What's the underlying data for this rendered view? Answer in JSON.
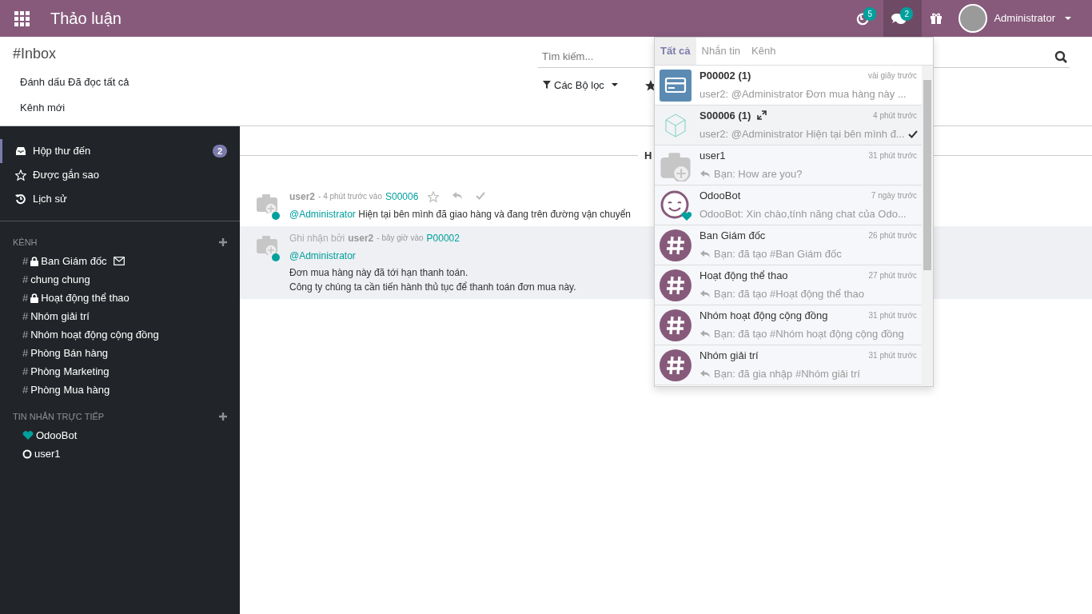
{
  "topbar": {
    "title": "Thảo luận",
    "activity_count": "5",
    "chat_count": "2",
    "chat_open": true,
    "user_name": "Administrator"
  },
  "control_panel": {
    "breadcrumb": "#Inbox",
    "buttons": [
      "Đánh dấu Đã đọc tất cả",
      "Kênh mới"
    ],
    "search": {
      "placeholder": "Tìm kiếm..."
    },
    "filters_label": "Các Bộ lọc"
  },
  "sidebar": {
    "mailboxes": [
      {
        "kind": "inbox",
        "label": "Hộp thư đến",
        "selected": true,
        "count": "2"
      },
      {
        "kind": "starred",
        "label": "Được gắn sao",
        "selected": false
      },
      {
        "kind": "history",
        "label": "Lịch sử",
        "selected": false
      }
    ],
    "channels_heading": "KÊNH",
    "channels": [
      {
        "hash": "#",
        "label": "Ban Giám đốc",
        "private": true,
        "email_notify": true
      },
      {
        "hash": "#",
        "label": "chung chung",
        "private": false,
        "email_notify": false
      },
      {
        "hash": "#",
        "label": "Hoạt động thể thao",
        "private": true,
        "email_notify": false
      },
      {
        "hash": "#",
        "label": "Nhóm giải trí",
        "private": false,
        "email_notify": false
      },
      {
        "hash": "#",
        "label": "Nhóm hoạt động cộng đồng",
        "private": false,
        "email_notify": false
      },
      {
        "hash": "#",
        "label": "Phòng Bán hàng",
        "private": false,
        "email_notify": false
      },
      {
        "hash": "#",
        "label": "Phòng Marketing",
        "private": false,
        "email_notify": false
      },
      {
        "hash": "#",
        "label": "Phòng Mua hàng",
        "private": false,
        "email_notify": false
      }
    ],
    "direct_heading": "TIN NHẮN TRỰC TIẾP",
    "direct": [
      {
        "label": "OdooBot",
        "kind": "bot"
      },
      {
        "label": "user1",
        "kind": "offline"
      }
    ]
  },
  "thread": {
    "separator": "H",
    "messages": [
      {
        "author": "user2",
        "date": "- 4 phút trước vào",
        "record": "S00006",
        "online": true,
        "highlighted": false,
        "actions": true,
        "mention": "@Administrator",
        "mention_inline": true,
        "lines": [
          "Hiện tại bên mình đã giao hàng và đang trên đường vận chuyển"
        ]
      },
      {
        "prefix": "Ghi nhận bởi",
        "author": "user2",
        "date": "- bây giờ vào",
        "record": "P00002",
        "online": true,
        "highlighted": true,
        "actions": false,
        "mention": "@Administrator",
        "mention_inline": false,
        "lines": [
          "Đơn mua hàng này đã tới hạn thanh toán.",
          "Công ty chúng ta cần tiến hành thủ tục để thanh toán đơn mua này."
        ]
      }
    ]
  },
  "dropdown": {
    "tabs": [
      {
        "label": "Tất cả",
        "selected": true
      },
      {
        "label": "Nhắn tin",
        "selected": false
      },
      {
        "label": "Kênh",
        "selected": false
      }
    ],
    "previews": [
      {
        "kind": "document",
        "name": "P00002 (1)",
        "time": "vài giây trước",
        "snippet": "user2: @Administrator Đơn mua hàng này ...",
        "unread": true,
        "hovered": false,
        "reply": false
      },
      {
        "kind": "box",
        "name": "S00006 (1)",
        "time": "4 phút trước",
        "snippet": "user2: @Administrator Hiện tại bên mình đ...",
        "unread": true,
        "hovered": true,
        "reply": false
      },
      {
        "kind": "user",
        "name": "user1",
        "time": "31 phút trước",
        "snippet": "Bạn: How are you?",
        "unread": false,
        "hovered": false,
        "reply": true
      },
      {
        "kind": "bot",
        "name": "OdooBot",
        "time": "7 ngày trước",
        "snippet": "OdooBot: Xin chào,tính năng chat của Odo...",
        "unread": false,
        "hovered": false,
        "reply": false
      },
      {
        "kind": "channel",
        "name": "Ban Giám đốc",
        "time": "26 phút trước",
        "snippet": "Bạn: đã tạo #Ban Giám đốc",
        "unread": false,
        "hovered": false,
        "reply": true
      },
      {
        "kind": "channel",
        "name": "Hoạt động thể thao",
        "time": "27 phút trước",
        "snippet": "Bạn: đã tạo #Hoạt động thể thao",
        "unread": false,
        "hovered": false,
        "reply": true
      },
      {
        "kind": "channel",
        "name": "Nhóm hoạt động cộng đồng",
        "time": "31 phút trước",
        "snippet": "Bạn: đã tạo #Nhóm hoạt động cộng đồng",
        "unread": false,
        "hovered": false,
        "reply": true
      },
      {
        "kind": "channel",
        "name": "Nhóm giải trí",
        "time": "31 phút trước",
        "snippet": "Bạn: đã gia nhập #Nhóm giải trí",
        "unread": false,
        "hovered": false,
        "reply": true
      }
    ]
  }
}
